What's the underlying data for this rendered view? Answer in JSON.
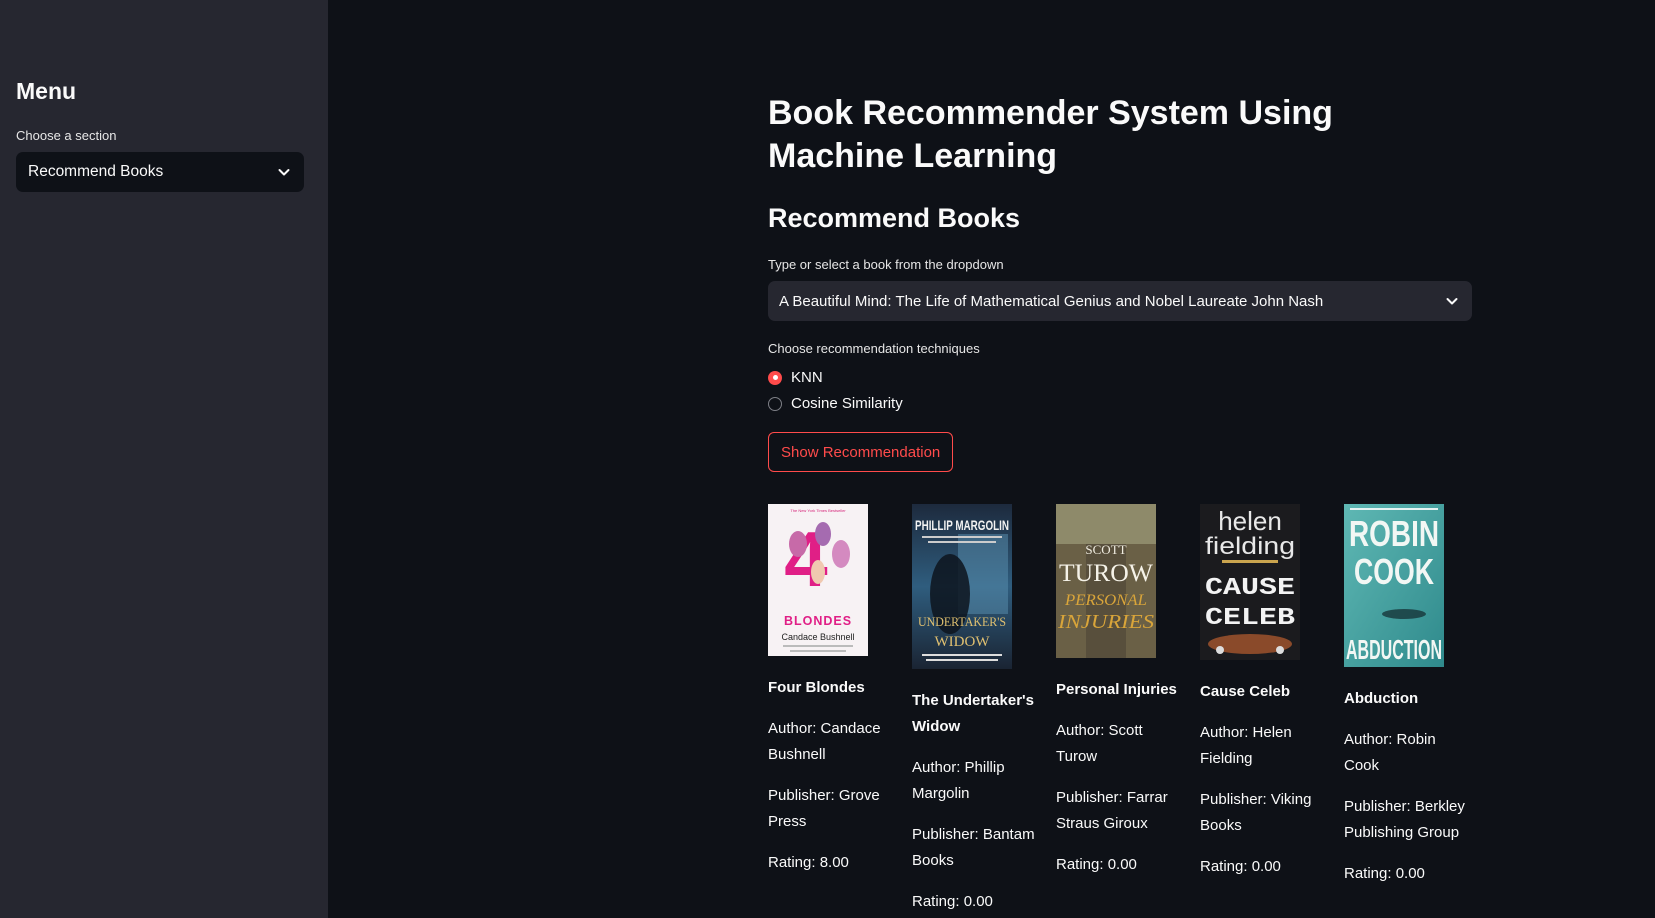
{
  "sidebar": {
    "title": "Menu",
    "section_label": "Choose a section",
    "section_value": "Recommend Books"
  },
  "main": {
    "page_title": "Book Recommender System Using Machine Learning",
    "section_title": "Recommend Books",
    "book_select_label": "Type or select a book from the dropdown",
    "book_select_value": "A Beautiful Mind: The Life of Mathematical Genius and Nobel Laureate John Nash",
    "technique_label": "Choose recommendation techniques",
    "techniques": [
      {
        "label": "KNN",
        "selected": true
      },
      {
        "label": "Cosine Similarity",
        "selected": false
      }
    ],
    "button_label": "Show Recommendation"
  },
  "books": [
    {
      "title": "Four Blondes",
      "author": "Author: Candace Bushnell",
      "publisher": "Publisher: Grove Press",
      "rating": "Rating: 8.00",
      "cover_lines": [
        "The New York Times Bestseller",
        "4",
        "BLONDES",
        "Candace Bushnell"
      ]
    },
    {
      "title": "The Undertaker's Widow",
      "author": "Author: Phillip Margolin",
      "publisher": "Publisher: Bantam Books",
      "rating": "Rating: 0.00",
      "cover_lines": [
        "PHILLIP MARGOLIN",
        "UNDERTAKER'S",
        "WIDOW"
      ]
    },
    {
      "title": "Personal Injuries",
      "author": "Author: Scott Turow",
      "publisher": "Publisher: Farrar Straus Giroux",
      "rating": "Rating: 0.00",
      "cover_lines": [
        "SCOTT",
        "TUROW",
        "PERSONAL",
        "INJURIES"
      ]
    },
    {
      "title": "Cause Celeb",
      "author": "Author: Helen Fielding",
      "publisher": "Publisher: Viking Books",
      "rating": "Rating: 0.00",
      "cover_lines": [
        "helen",
        "fielding",
        "CAUSE",
        "CELEB"
      ]
    },
    {
      "title": "Abduction",
      "author": "Author: Robin Cook",
      "publisher": "Publisher: Berkley Publishing Group",
      "rating": "Rating: 0.00",
      "cover_lines": [
        "ROBIN",
        "COOK",
        "ABDUCTION"
      ]
    }
  ],
  "colors": {
    "accent": "#ff4b4b",
    "background": "#0e1117",
    "sidebar": "#262730"
  }
}
